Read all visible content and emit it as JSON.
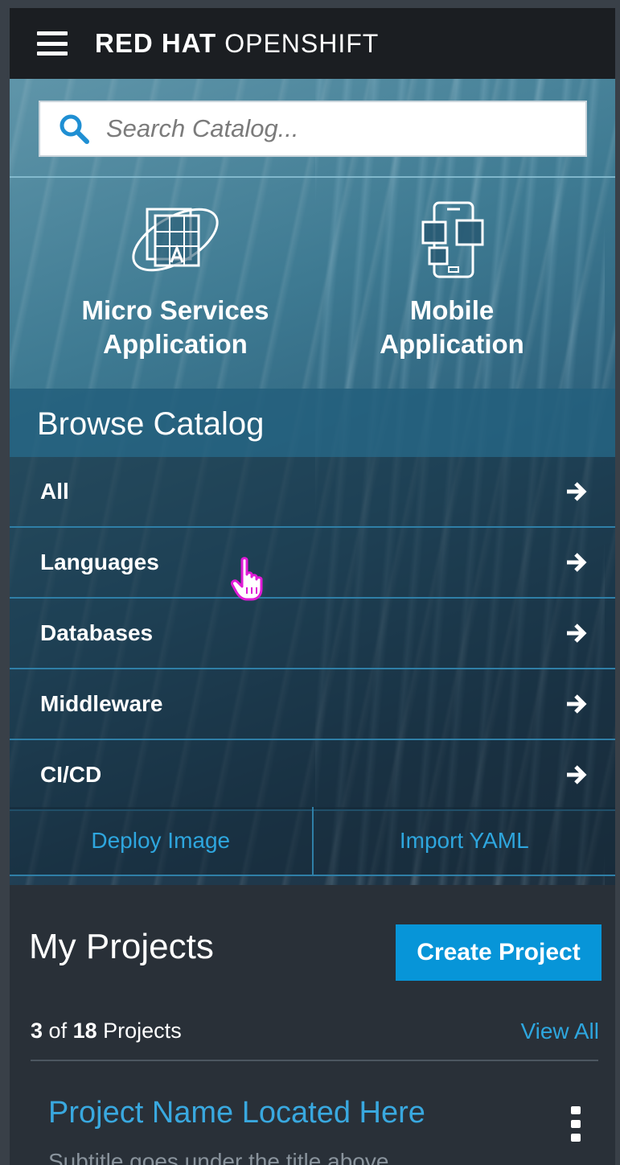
{
  "header": {
    "brand_bold": "RED HAT",
    "brand_light": "OPENSHIFT",
    "menu_icon": "hamburger-menu-icon"
  },
  "search": {
    "placeholder": "Search Catalog...",
    "icon": "search-icon"
  },
  "tiles": [
    {
      "line1": "Micro Services",
      "line2": "Application",
      "icon": "microservices-icon"
    },
    {
      "line1": "Mobile",
      "line2": "Application",
      "icon": "mobile-devices-icon"
    }
  ],
  "browse": {
    "title": "Browse Catalog",
    "items": [
      {
        "label": "All"
      },
      {
        "label": "Languages"
      },
      {
        "label": "Databases"
      },
      {
        "label": "Middleware"
      },
      {
        "label": "CI/CD"
      }
    ],
    "deploy_image": "Deploy Image",
    "import_yaml": "Import YAML"
  },
  "projects": {
    "title": "My Projects",
    "create_label": "Create Project",
    "count_shown": "3",
    "count_of": "of",
    "count_total": "18",
    "count_suffix": "Projects",
    "view_all": "View All",
    "first_title": "Project Name Located Here",
    "first_subtitle": "Subtitle goes under the title above"
  },
  "colors": {
    "accent": "#0795d8",
    "link": "#2ea6de",
    "header_bg": "#1b1e22",
    "panel_bg": "#293038",
    "cursor": "#e01ad6"
  }
}
